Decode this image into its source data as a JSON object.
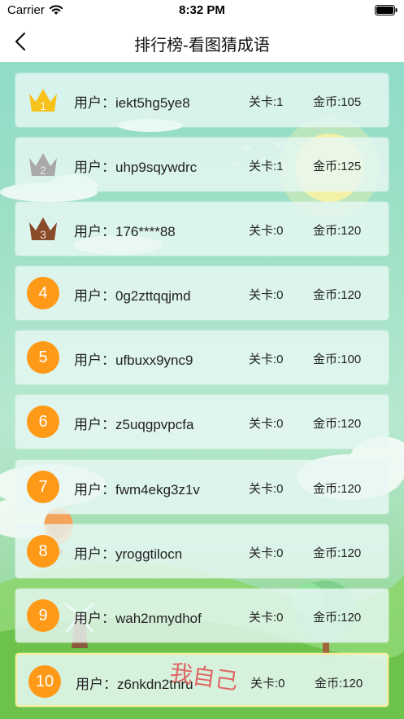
{
  "status_bar": {
    "carrier": "Carrier",
    "time": "8:32 PM",
    "wifi_icon": "wifi-icon",
    "battery_icon": "battery-full-icon"
  },
  "nav": {
    "title": "排行榜-看图猜成语",
    "back_icon": "chevron-left-icon"
  },
  "colors": {
    "rank_circle": "#ff9a18",
    "gold_crown": "#f7c21a",
    "silver_crown": "#a9a9a9",
    "bronze_crown": "#8a4b2a",
    "self_mark": "#e05a5a"
  },
  "leaderboard": [
    {
      "rank": "1",
      "badge": "gold-crown-icon",
      "user": "用户：iekt5hg5ye8",
      "level": "关卡:1",
      "coins": "金币:105"
    },
    {
      "rank": "2",
      "badge": "silver-crown-icon",
      "user": "用户：uhp9sqywdrc",
      "level": "关卡:1",
      "coins": "金币:125"
    },
    {
      "rank": "3",
      "badge": "bronze-crown-icon",
      "user": "用户：176****88",
      "level": "关卡:0",
      "coins": "金币:120"
    },
    {
      "rank": "4",
      "user": "用户：0g2zttqqjmd",
      "level": "关卡:0",
      "coins": "金币:120"
    },
    {
      "rank": "5",
      "user": "用户：ufbuxx9ync9",
      "level": "关卡:0",
      "coins": "金币:100"
    },
    {
      "rank": "6",
      "user": "用户：z5uqgpvpcfa",
      "level": "关卡:0",
      "coins": "金币:120"
    },
    {
      "rank": "7",
      "user": "用户：fwm4ekg3z1v",
      "level": "关卡:0",
      "coins": "金币:120"
    },
    {
      "rank": "8",
      "user": "用户：yroggtilocn",
      "level": "关卡:0",
      "coins": "金币:120"
    },
    {
      "rank": "9",
      "user": "用户：wah2nmydhof",
      "level": "关卡:0",
      "coins": "金币:120"
    },
    {
      "rank": "10",
      "user": "用户：z6nkdn2tnru",
      "level": "关卡:0",
      "coins": "金币:120",
      "self_mark": "我自己"
    }
  ]
}
